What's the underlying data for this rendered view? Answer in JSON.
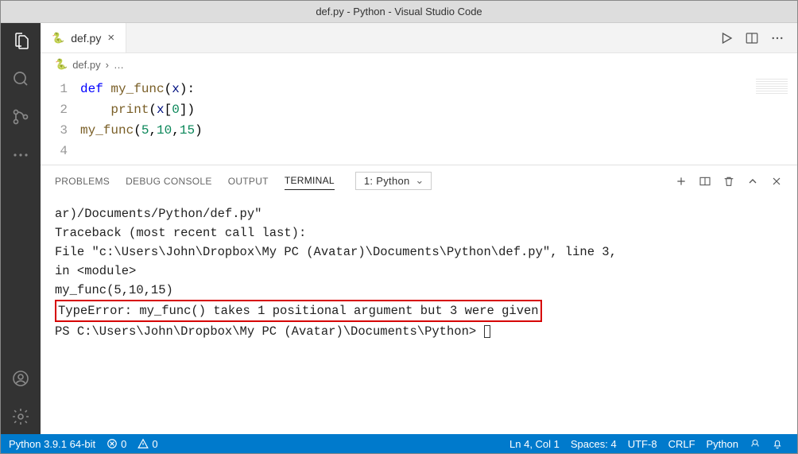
{
  "titlebar": "def.py - Python - Visual Studio Code",
  "tab": {
    "filename": "def.py"
  },
  "breadcrumb": {
    "file": "def.py",
    "rest": "…"
  },
  "code": {
    "lines": [
      "1",
      "2",
      "3",
      "4"
    ],
    "l1_kw": "def ",
    "l1_fn": "my_func",
    "l1_param": "x",
    "l2_fn": "print",
    "l2_var": "x",
    "l2_idx": "0",
    "l3_fn": "my_func",
    "l3_a": "5",
    "l3_b": "10",
    "l3_c": "15"
  },
  "panel": {
    "tabs": {
      "problems": "PROBLEMS",
      "debug": "DEBUG CONSOLE",
      "output": "OUTPUT",
      "terminal": "TERMINAL"
    },
    "dropdown": "1: Python"
  },
  "terminal": {
    "l1": "ar)/Documents/Python/def.py\"",
    "l2": "Traceback (most recent call last):",
    "l3": "  File \"c:\\Users\\John\\Dropbox\\My PC (Avatar)\\Documents\\Python\\def.py\", line 3,",
    "l4": "in <module>",
    "l5": "    my_func(5,10,15)",
    "l6": "TypeError: my_func() takes 1 positional argument but 3 were given",
    "l7_pre": "PS C:\\Users\\John\\Dropbox\\My PC (Avatar)\\Documents\\Python> "
  },
  "status": {
    "python": "Python 3.9.1 64-bit",
    "err": "0",
    "warn": "0",
    "ln": "Ln 4, Col 1",
    "spaces": "Spaces: 4",
    "enc": "UTF-8",
    "eol": "CRLF",
    "lang": "Python"
  }
}
